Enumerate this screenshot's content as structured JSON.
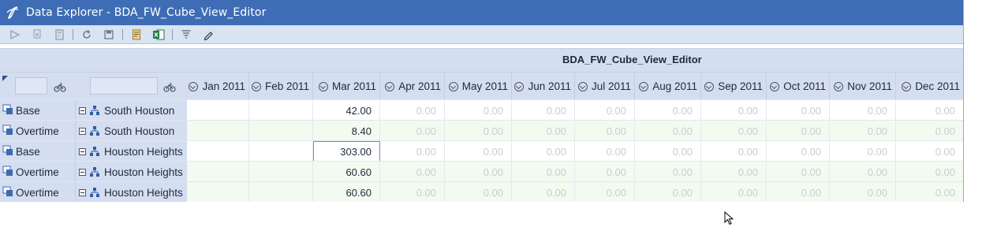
{
  "window": {
    "title": "Data Explorer - BDA_FW_Cube_View_Editor"
  },
  "toolbar": {
    "buttons": [
      {
        "name": "run-icon"
      },
      {
        "name": "copy-icon"
      },
      {
        "name": "calculator-icon"
      },
      {
        "name": "refresh-icon"
      },
      {
        "name": "save-icon"
      },
      {
        "name": "report-icon"
      },
      {
        "name": "excel-icon"
      },
      {
        "name": "filter-icon"
      },
      {
        "name": "edit-icon"
      }
    ]
  },
  "grid": {
    "title": "BDA_FW_Cube_View_Editor",
    "columns": [
      "Jan 2011",
      "Feb 2011",
      "Mar 2011",
      "Apr 2011",
      "May 2011",
      "Jun 2011",
      "Jul 2011",
      "Aug 2011",
      "Sep 2011",
      "Oct 2011",
      "Nov 2011",
      "Dec 2011"
    ],
    "rows": [
      {
        "account": "Base",
        "entity": "South Houston",
        "cells": [
          "",
          "",
          "42.00",
          "0.00",
          "0.00",
          "0.00",
          "0.00",
          "0.00",
          "0.00",
          "0.00",
          "0.00",
          "0.00"
        ]
      },
      {
        "account": "Overtime",
        "entity": "South Houston",
        "cells": [
          "",
          "",
          "8.40",
          "0.00",
          "0.00",
          "0.00",
          "0.00",
          "0.00",
          "0.00",
          "0.00",
          "0.00",
          "0.00"
        ]
      },
      {
        "account": "Base",
        "entity": "Houston Heights",
        "cells": [
          "",
          "",
          "303.00",
          "0.00",
          "0.00",
          "0.00",
          "0.00",
          "0.00",
          "0.00",
          "0.00",
          "0.00",
          "0.00"
        ]
      },
      {
        "account": "Overtime",
        "entity": "Houston Heights",
        "cells": [
          "",
          "",
          "60.60",
          "0.00",
          "0.00",
          "0.00",
          "0.00",
          "0.00",
          "0.00",
          "0.00",
          "0.00",
          "0.00"
        ]
      },
      {
        "account": "Overtime",
        "entity": "Houston Heights",
        "cells": [
          "",
          "",
          "60.60",
          "0.00",
          "0.00",
          "0.00",
          "0.00",
          "0.00",
          "0.00",
          "0.00",
          "0.00",
          "0.00"
        ]
      }
    ]
  },
  "colors": {
    "titlebar": "#3e6db5",
    "toolbar": "#d9e3f1",
    "header": "#d4def0",
    "zero_text": "#c8cdd4",
    "alt_row": "#f3faf0"
  }
}
